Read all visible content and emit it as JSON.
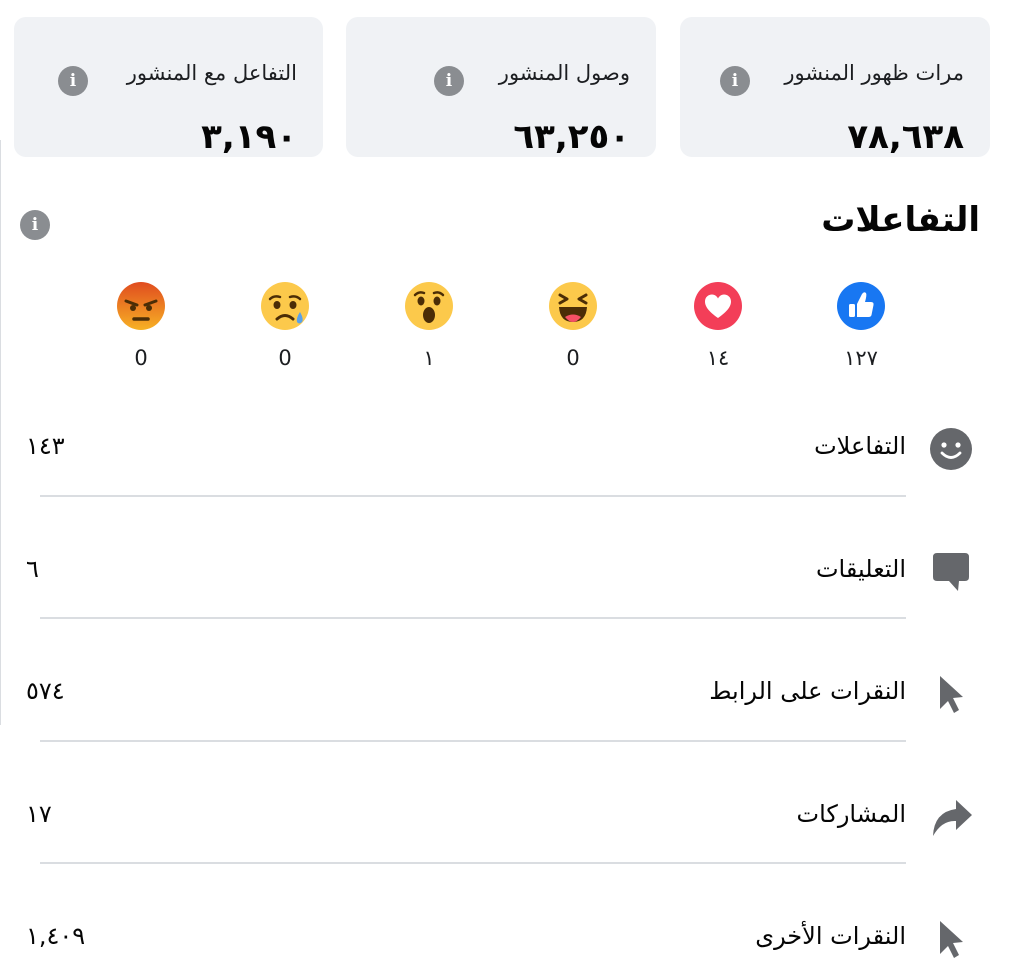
{
  "cards": [
    {
      "label": "مرات ظهور المنشور",
      "value": "٧٨,٦٣٨"
    },
    {
      "label": "وصول المنشور",
      "value": "٦٣,٢٥٠"
    },
    {
      "label": "التفاعل مع المنشور",
      "value": "٣,١٩٠"
    }
  ],
  "info_icon_glyph": "i",
  "reactions": {
    "title": "التفاعلات",
    "items": [
      {
        "name": "like-icon",
        "count": "١٢٧"
      },
      {
        "name": "love-icon",
        "count": "١٤"
      },
      {
        "name": "haha-icon",
        "count": "0"
      },
      {
        "name": "wow-icon",
        "count": "١"
      },
      {
        "name": "sad-icon",
        "count": "0"
      },
      {
        "name": "angry-icon",
        "count": "0"
      }
    ]
  },
  "metrics": [
    {
      "icon": "smiley-icon",
      "label": "التفاعلات",
      "value": "١٤٣"
    },
    {
      "icon": "comment-icon",
      "label": "التعليقات",
      "value": "٦"
    },
    {
      "icon": "cursor-icon",
      "label": "النقرات على الرابط",
      "value": "٥٧٤"
    },
    {
      "icon": "share-icon",
      "label": "المشاركات",
      "value": "١٧"
    },
    {
      "icon": "cursor-icon",
      "label": "النقرات الأخرى",
      "value": "١,٤٠٩"
    }
  ],
  "colors": {
    "card_bg": "#f0f2f5",
    "info_icon": "#8a8d91",
    "metric_icon": "#65676b",
    "divider": "#dadde1",
    "like_blue": "#1877f2",
    "love_red": "#f33e58",
    "emoji_yellow": "#fcc94b",
    "angry_red": "#e9710f"
  }
}
